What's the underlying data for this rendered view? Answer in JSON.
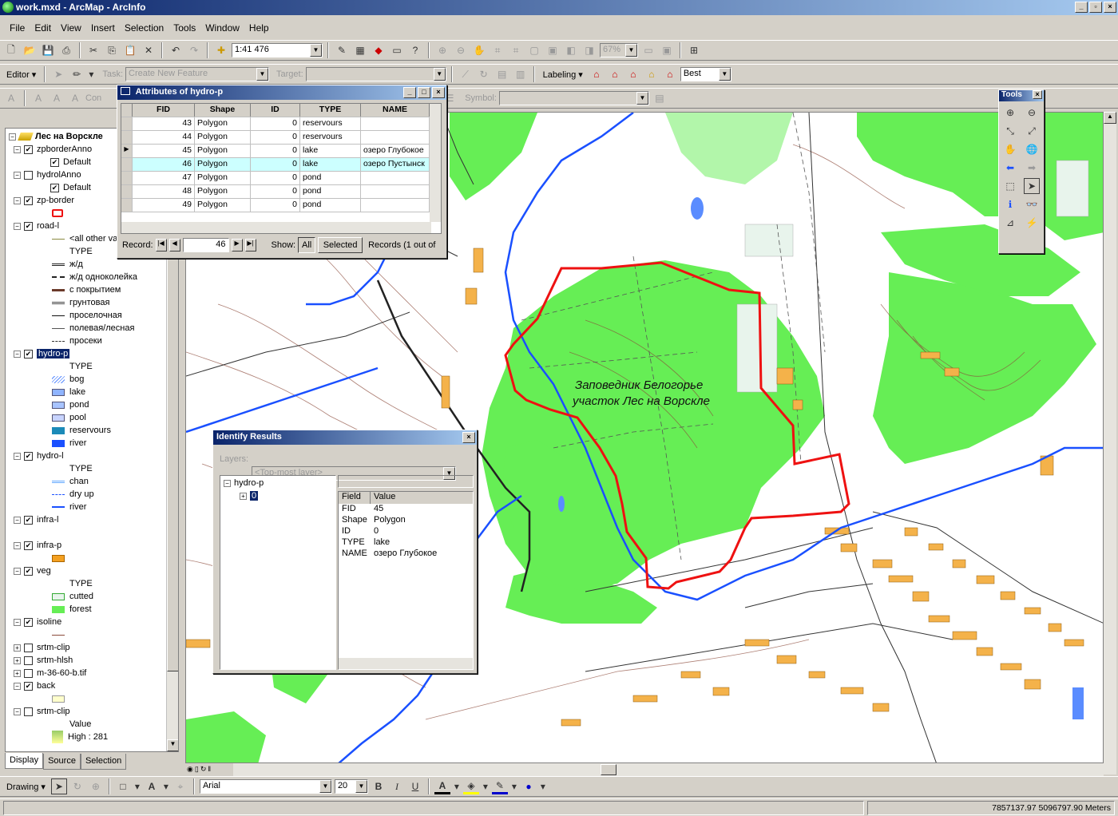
{
  "app": {
    "title": "work.mxd - ArcMap - ArcInfo"
  },
  "menu": [
    "File",
    "Edit",
    "View",
    "Insert",
    "Selection",
    "Tools",
    "Window",
    "Help"
  ],
  "standard_toolbar": {
    "scale": "1:41 476",
    "zoom": "67%"
  },
  "editor_toolbar": {
    "editor_label": "Editor",
    "task_label": "Task:",
    "task_value": "Create New Feature",
    "target_label": "Target:"
  },
  "labeling_toolbar": {
    "labeling_label": "Labeling",
    "quality": "Best"
  },
  "annotation_toolbar": {
    "con_label": "Con",
    "symbol_label": "Symbol:"
  },
  "toc": {
    "frame": "Лес на Ворскле",
    "rows": [
      {
        "type": "layer",
        "label": "zpborderAnno",
        "checked": true,
        "expanded": true
      },
      {
        "type": "sub",
        "label": "Default",
        "checked": true
      },
      {
        "type": "layer",
        "label": "hydrolAnno",
        "checked": false,
        "expanded": true
      },
      {
        "type": "sub",
        "label": "Default",
        "checked": true
      },
      {
        "type": "layer",
        "label": "zp-border",
        "checked": true,
        "expanded": true
      },
      {
        "type": "legend",
        "label": "",
        "swatch": "redbox"
      },
      {
        "type": "layer",
        "label": "road-l",
        "checked": true,
        "expanded": true
      },
      {
        "type": "legend",
        "label": "<all other va",
        "swatch": "line-olive"
      },
      {
        "type": "legend",
        "label": "TYPE",
        "swatch": "none"
      },
      {
        "type": "legend",
        "label": "ж/д",
        "swatch": "rail"
      },
      {
        "type": "legend",
        "label": "ж/д одноколейка",
        "swatch": "rail1"
      },
      {
        "type": "legend",
        "label": "с покрытием",
        "swatch": "line-brown"
      },
      {
        "type": "legend",
        "label": "грунтовая",
        "swatch": "line-double"
      },
      {
        "type": "legend",
        "label": "проселочная",
        "swatch": "line-black"
      },
      {
        "type": "legend",
        "label": "полевая/лесная",
        "swatch": "line-thin"
      },
      {
        "type": "legend",
        "label": "просеки",
        "swatch": "line-dash"
      },
      {
        "type": "layer",
        "label": "hydro-p",
        "checked": true,
        "expanded": true,
        "selected": true
      },
      {
        "type": "legend",
        "label": "TYPE",
        "swatch": "none"
      },
      {
        "type": "legend",
        "label": "bog",
        "swatch": "bog"
      },
      {
        "type": "legend",
        "label": "lake",
        "swatch": "lake"
      },
      {
        "type": "legend",
        "label": "pond",
        "swatch": "pond"
      },
      {
        "type": "legend",
        "label": "pool",
        "swatch": "pool"
      },
      {
        "type": "legend",
        "label": "reservours",
        "swatch": "reservours"
      },
      {
        "type": "legend",
        "label": "river",
        "swatch": "river"
      },
      {
        "type": "layer",
        "label": "hydro-l",
        "checked": true,
        "expanded": true
      },
      {
        "type": "legend",
        "label": "TYPE",
        "swatch": "none"
      },
      {
        "type": "legend",
        "label": "chan",
        "swatch": "chan"
      },
      {
        "type": "legend",
        "label": "dry up",
        "swatch": "dryup"
      },
      {
        "type": "legend",
        "label": "river",
        "swatch": "riverline"
      },
      {
        "type": "layer",
        "label": "infra-l",
        "checked": true,
        "expanded": true
      },
      {
        "type": "legend",
        "label": "",
        "swatch": "none"
      },
      {
        "type": "layer",
        "label": "infra-p",
        "checked": true,
        "expanded": true
      },
      {
        "type": "legend",
        "label": "",
        "swatch": "orange"
      },
      {
        "type": "layer",
        "label": "veg",
        "checked": true,
        "expanded": true
      },
      {
        "type": "legend",
        "label": "TYPE",
        "swatch": "none"
      },
      {
        "type": "legend",
        "label": "cutted",
        "swatch": "cutted"
      },
      {
        "type": "legend",
        "label": "forest",
        "swatch": "forest"
      },
      {
        "type": "layer",
        "label": "isoline",
        "checked": true,
        "expanded": true
      },
      {
        "type": "legend",
        "label": "",
        "swatch": "isoline"
      },
      {
        "type": "layer",
        "label": "srtm-clip",
        "checked": false,
        "expanded": false
      },
      {
        "type": "layer",
        "label": "srtm-hlsh",
        "checked": false,
        "expanded": false
      },
      {
        "type": "layer",
        "label": "m-36-60-b.tif",
        "checked": false,
        "expanded": false
      },
      {
        "type": "layer",
        "label": "back",
        "checked": true,
        "expanded": true
      },
      {
        "type": "legend",
        "label": "",
        "swatch": "back"
      },
      {
        "type": "layer",
        "label": "srtm-clip",
        "checked": false,
        "expanded": true
      },
      {
        "type": "legend",
        "label": "Value",
        "swatch": "none"
      },
      {
        "type": "legend",
        "label": "High : 281",
        "swatch": "ramp"
      }
    ],
    "tabs": [
      "Display",
      "Source",
      "Selection"
    ]
  },
  "attributes": {
    "title": "Attributes of hydro-p",
    "columns": [
      "FID",
      "Shape",
      "ID",
      "TYPE",
      "NAME"
    ],
    "rows": [
      [
        "43",
        "Polygon",
        "0",
        "reservours",
        ""
      ],
      [
        "44",
        "Polygon",
        "0",
        "reservours",
        ""
      ],
      [
        "45",
        "Polygon",
        "0",
        "lake",
        "озеро Глубокое"
      ],
      [
        "46",
        "Polygon",
        "0",
        "lake",
        "озеро Пустынск"
      ],
      [
        "47",
        "Polygon",
        "0",
        "pond",
        ""
      ],
      [
        "48",
        "Polygon",
        "0",
        "pond",
        ""
      ],
      [
        "49",
        "Polygon",
        "0",
        "pond",
        ""
      ]
    ],
    "record_label": "Record:",
    "record_value": "46",
    "show_label": "Show:",
    "show_all": "All",
    "show_selected": "Selected",
    "records_text": "Records (1 out of"
  },
  "identify": {
    "title": "Identify Results",
    "layers_label": "Layers:",
    "layers_value": "<Top-most layer>",
    "tree_layer": "hydro-p",
    "tree_item": "0",
    "col_field": "Field",
    "col_value": "Value",
    "fields": [
      [
        "FID",
        "45"
      ],
      [
        "Shape",
        "Polygon"
      ],
      [
        "ID",
        "0"
      ],
      [
        "TYPE",
        "lake"
      ],
      [
        "NAME",
        "озеро Глубокое"
      ]
    ]
  },
  "tools_window": {
    "title": "Tools"
  },
  "map": {
    "label_line1": "Заповедник Белогорье",
    "label_line2": "участок Лес на Ворскле"
  },
  "drawing_toolbar": {
    "drawing_label": "Drawing",
    "font": "Arial",
    "size": "20",
    "bold": "B",
    "italic": "I",
    "underline": "U",
    "font_color_letter": "A"
  },
  "status": {
    "coords": "7857137.97  5096797.90 Meters"
  },
  "colors": {
    "forest": "#66ee55",
    "river": "#1a50ff",
    "border": "#ee1111",
    "urban": "#f4b24a"
  }
}
